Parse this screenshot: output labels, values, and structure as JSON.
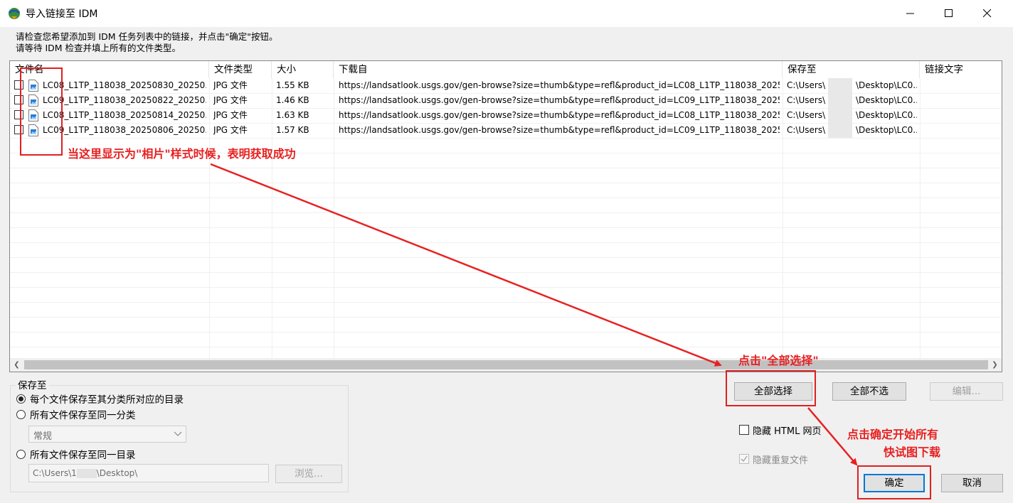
{
  "window": {
    "title": "导入链接至 IDM"
  },
  "instructions": [
    "请检查您希望添加到 IDM 任务列表中的链接，并点击\"确定\"按钮。",
    "请等待 IDM 检查并填上所有的文件类型。"
  ],
  "table": {
    "columns": [
      "文件名",
      "文件类型",
      "大小",
      "下载自",
      "保存至",
      "链接文字"
    ],
    "rows": [
      {
        "checked": false,
        "name": "LC08_L1TP_118038_20250830_20250...",
        "type": "JPG 文件",
        "size": "1.55  KB",
        "url": "https://landsatlook.usgs.gov/gen-browse?size=thumb&type=refl&product_id=LC08_L1TP_118038_20250...",
        "save_a": "C:\\Users\\",
        "save_b": "\\Desktop\\LC0...",
        "link_text": ""
      },
      {
        "checked": false,
        "name": "LC09_L1TP_118038_20250822_20250...",
        "type": "JPG 文件",
        "size": "1.46  KB",
        "url": "https://landsatlook.usgs.gov/gen-browse?size=thumb&type=refl&product_id=LC09_L1TP_118038_20250...",
        "save_a": "C:\\Users\\",
        "save_b": "\\Desktop\\LC0...",
        "link_text": ""
      },
      {
        "checked": false,
        "name": "LC08_L1TP_118038_20250814_20250...",
        "type": "JPG 文件",
        "size": "1.63  KB",
        "url": "https://landsatlook.usgs.gov/gen-browse?size=thumb&type=refl&product_id=LC08_L1TP_118038_20250...",
        "save_a": "C:\\Users\\",
        "save_b": "\\Desktop\\LC0...",
        "link_text": ""
      },
      {
        "checked": false,
        "name": "LC09_L1TP_118038_20250806_20250...",
        "type": "JPG 文件",
        "size": "1.57  KB",
        "url": "https://landsatlook.usgs.gov/gen-browse?size=thumb&type=refl&product_id=LC09_L1TP_118038_20250...",
        "save_a": "C:\\Users\\",
        "save_b": "\\Desktop\\LC0...",
        "link_text": ""
      }
    ]
  },
  "save_group": {
    "label": "保存至",
    "option1": "每个文件保存至其分类所对应的目录",
    "option2": "所有文件保存至同一分类",
    "category_value": "常规",
    "option3": "所有文件保存至同一目录",
    "path_a": "C:\\Users\\1",
    "path_b": "\\Desktop\\",
    "browse_label": "浏览..."
  },
  "buttons": {
    "select_all": "全部选择",
    "deselect_all": "全部不选",
    "edit": "编辑...",
    "ok": "确定",
    "cancel": "取消"
  },
  "options": {
    "hide_html": "隐藏 HTML 网页",
    "hide_duplicates": "隐藏重复文件",
    "hide_duplicates_checked": true
  },
  "annotations": {
    "photo_hint": "当这里显示为\"相片\"样式时候，表明获取成功",
    "select_all_hint": "点击\"全部选择\"",
    "ok_hint_line1": "点击确定开始所有",
    "ok_hint_line2": "快试图下载",
    "color": "#e82020"
  }
}
